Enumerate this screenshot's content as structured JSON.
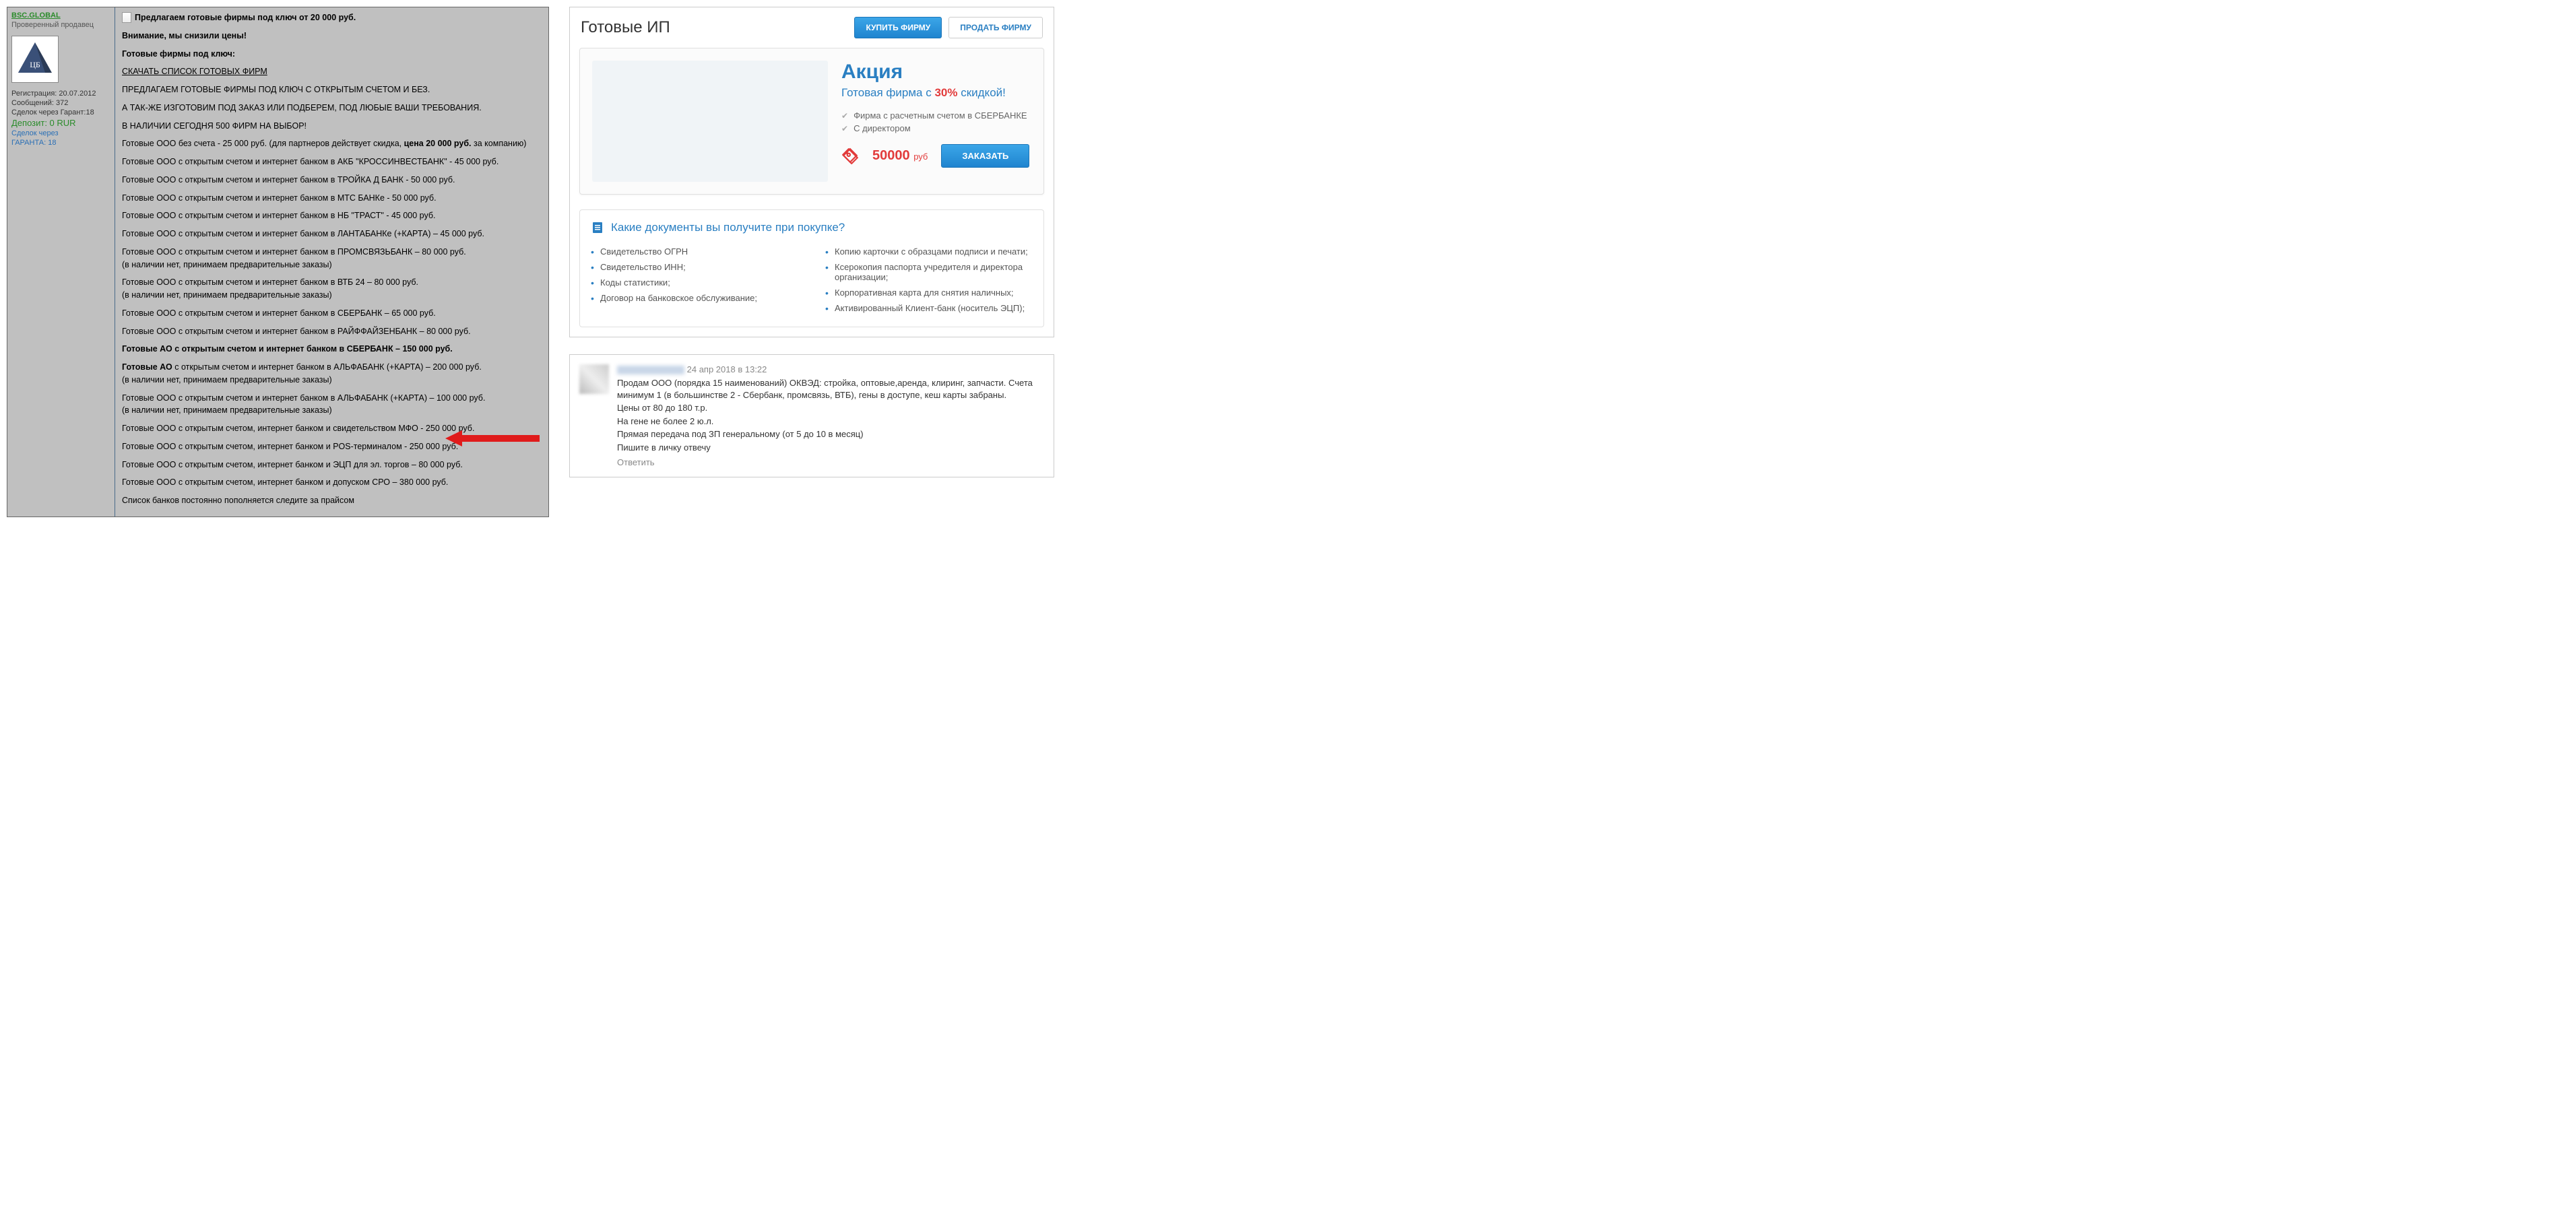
{
  "seller": {
    "name": "BSC.GLOBAL",
    "verified": "Проверенный продавец",
    "registered": "Регистрация: 20.07.2012",
    "messages": "Сообщений: 372",
    "deals": "Сделок через Гарант:18",
    "deposit": "Депозит: 0 RUR",
    "deals_via": "Сделок через",
    "guarantor": "ГАРАНТА: 18"
  },
  "post": {
    "title": "Предлагаем готовые фирмы под ключ от 20 000 руб.",
    "attention": "Внимание, мы снизили цены!",
    "turnkey": "Готовые фирмы под ключ:",
    "download": "СКАЧАТЬ СПИСОК ГОТОВЫХ ФИРМ",
    "l1": "ПРЕДЛАГАЕМ ГОТОВЫЕ ФИРМЫ ПОД КЛЮЧ С ОТКРЫТЫМ СЧЕТОМ И БЕЗ.",
    "l2": "А ТАК-ЖЕ ИЗГОТОВИМ ПОД ЗАКАЗ ИЛИ ПОДБЕРЕМ, ПОД ЛЮБЫЕ ВАШИ ТРЕБОВАНИЯ.",
    "l3": "В НАЛИЧИИ СЕГОДНЯ 500 ФИРМ НА ВЫБОР!",
    "p1_a": "Готовые ООО без счета - 25 000 руб. (для партнеров действует скидка, ",
    "p1_b": "цена 20 000 руб.",
    "p1_c": " за компанию)",
    "p2": "Готовые ООО с открытым счетом и интернет банком в АКБ \"КРОССИНВЕСТБАНК\" - 45 000 руб.",
    "p3": "Готовые ООО с открытым счетом и интернет банком в ТРОЙКА Д БАНК - 50 000 руб.",
    "p4": "Готовые ООО с открытым счетом и интернет банком в МТС БАНКе - 50 000 руб.",
    "p5": "Готовые ООО с открытым счетом и интернет банком в НБ \"ТРАСТ\" - 45 000 руб.",
    "p6": "Готовые ООО с открытым счетом и интернет банком в ЛАНТАБАНКе (+КАРТА) – 45 000 руб.",
    "p7a": "Готовые ООО с открытым счетом и интернет банком в ПРОМСВЯЗЬБАНК – 80 000 руб.",
    "p7b": "(в наличии нет, принимаем предварительные заказы)",
    "p8a": "Готовые ООО с открытым счетом и интернет банком в ВТБ 24 – 80 000 руб.",
    "p8b": "(в наличии нет, принимаем предварительные заказы)",
    "p9": "Готовые ООО с открытым счетом и интернет банком в СБЕРБАНК – 65 000 руб.",
    "p10": "Готовые ООО с открытым счетом и интернет банком в РАЙФФАЙЗЕНБАНК – 80 000 руб.",
    "p11": "Готовые АО с открытым счетом и интернет банком в СБЕРБАНК – 150 000 руб.",
    "p12a": "Готовые АО",
    "p12b": " с открытым счетом и интернет банком в АЛЬФАБАНК (+КАРТА) – 200 000 руб.",
    "p12c": "(в наличии нет, принимаем предварительные заказы)",
    "p13a": "Готовые ООО с открытым счетом и интернет банком в АЛЬФАБАНК (+КАРТА) – 100 000 руб.",
    "p13b": "(в наличии нет, принимаем предварительные заказы)",
    "p14": "Готовые ООО с открытым счетом, интернет банком и свидетельством МФО - 250 000 руб.",
    "p15": "Готовые ООО с открытым счетом, интернет банком и POS-терминалом - 250 000 руб.",
    "p16": "Готовые ООО с открытым счетом, интернет банком и ЭЦП для эл. торгов – 80 000 руб.",
    "p17": "Готовые ООО с открытым счетом, интернет банком и допуском СРО – 380 000 руб.",
    "p18": "Список банков постоянно пополняется следите за прайсом"
  },
  "shop": {
    "title": "Готовые ИП",
    "buy": "КУПИТЬ ФИРМУ",
    "sell": "ПРОДАТЬ ФИРМУ",
    "promo_title": "Акция",
    "promo_sub_a": "Готовая фирма с ",
    "promo_sub_b": "30%",
    "promo_sub_c": " скидкой!",
    "feat1": "Фирма с расчетным счетом в СБЕРБАНКЕ",
    "feat2": "С директором",
    "price": "50000",
    "cur": "руб",
    "order": "ЗАКАЗАТЬ",
    "docs_title": "Какие документы вы получите при покупке?",
    "docs_left": [
      "Свидетельство ОГРН",
      "Свидетельство ИНН;",
      "Коды статистики;",
      "Договор на банковское обслуживание;"
    ],
    "docs_right": [
      "Копию карточки с образцами подписи и печати;",
      "Ксерокопия паспорта учредителя и директора организации;",
      "Корпоративная карта для снятия наличных;",
      "Активированный Клиент-банк (носитель ЭЦП);"
    ]
  },
  "comment": {
    "date": "24 апр 2018 в 13:22",
    "l1": "Продам ООО (порядка 15 наименований) ОКВЭД: стройка, оптовые,аренда, клиринг, запчасти. Счета минимум 1 (в большинстве 2 - Сбербанк, промсвязь, ВТБ), гены в доступе, кеш карты забраны.",
    "l2": "Цены от 80 до 180 т.р.",
    "l3": "На гене не более 2 ю.л.",
    "l4": "Прямая передача под ЗП генеральному (от 5 до 10 в месяц)",
    "l5": "Пишите в личку отвечу",
    "reply": "Ответить"
  }
}
